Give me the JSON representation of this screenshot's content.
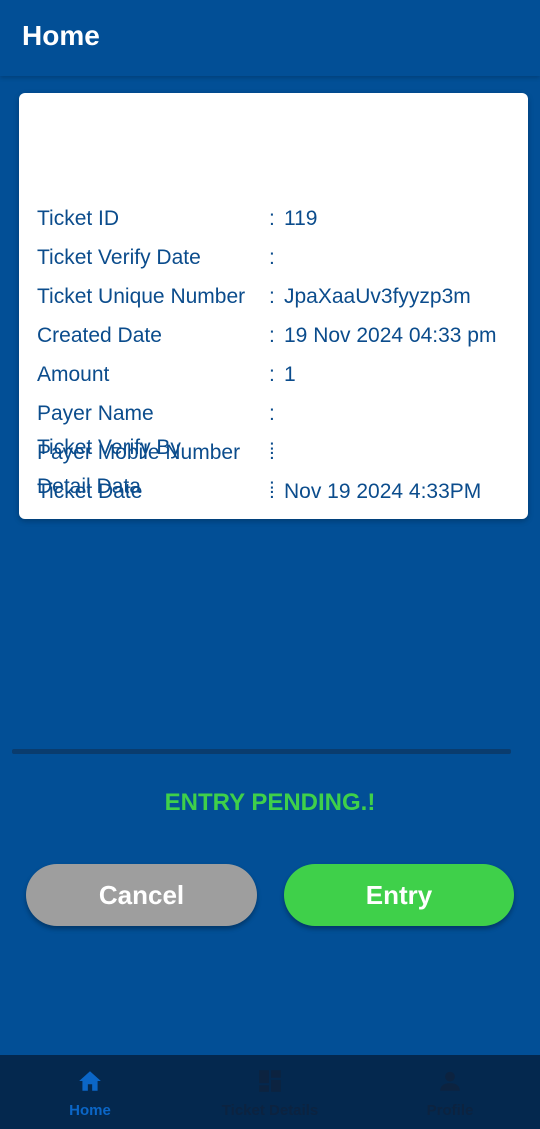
{
  "app_bar": {
    "title": "Home"
  },
  "ticket": {
    "rows": [
      {
        "label": "Ticket ID",
        "colon": ":",
        "value": "119"
      },
      {
        "label": "Ticket Verify Date",
        "colon": ":",
        "value": ""
      },
      {
        "label": "Ticket Unique Number",
        "colon": ":",
        "value": "JpaXaaUv3fyyzp3m"
      },
      {
        "label": "Created Date",
        "colon": ":",
        "value": "19 Nov 2024 04:33 pm"
      },
      {
        "label": "Amount",
        "colon": ":",
        "value": "1"
      },
      {
        "label": "Payer Name",
        "colon": ":",
        "value": ""
      },
      {
        "label": "Payer Mobile Number",
        "colon": ":",
        "value": ""
      },
      {
        "label": "Ticket Date",
        "colon": ":",
        "value": "Nov 19 2024  4:33PM"
      },
      {
        "label": "Ticket Verify By",
        "colon": ":",
        "value": ""
      },
      {
        "label": "Detail Data",
        "colon": ":",
        "value": ""
      }
    ]
  },
  "status": {
    "text": "ENTRY PENDING.!",
    "color": "#3FD04A"
  },
  "actions": {
    "cancel_label": "Cancel",
    "entry_label": "Entry"
  },
  "bottom_nav": {
    "items": [
      {
        "label": "Home",
        "icon": "home-icon",
        "active": true
      },
      {
        "label": "Ticket Details",
        "icon": "dashboard-icon",
        "active": false
      },
      {
        "label": "Profile",
        "icon": "person-icon",
        "active": false
      }
    ]
  },
  "colors": {
    "background": "#024F96",
    "accent_green": "#3FD04A",
    "cancel_gray": "#9E9E9E",
    "nav_background": "#04284E",
    "nav_active": "#0B66C7"
  }
}
